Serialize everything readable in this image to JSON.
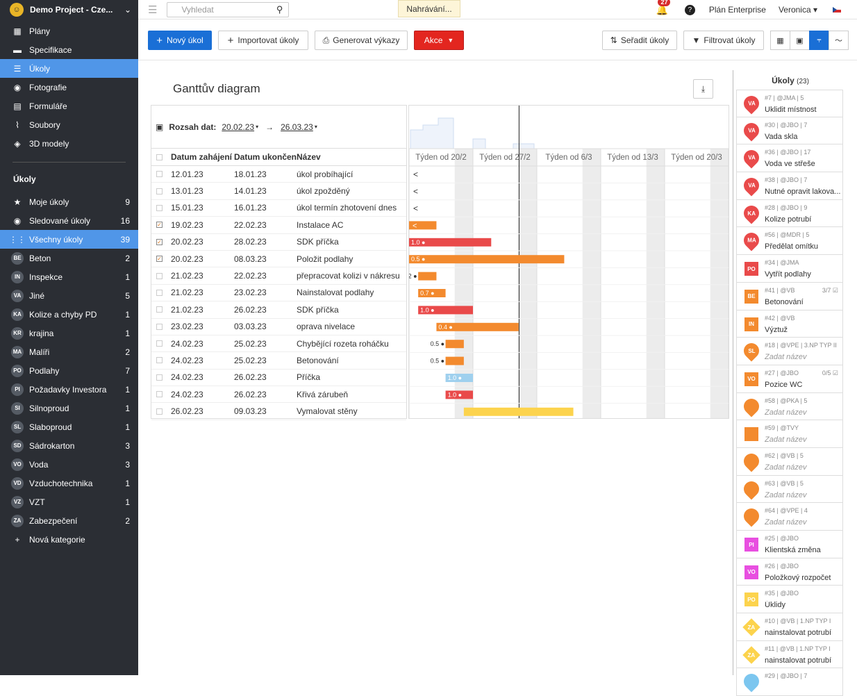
{
  "app": {
    "project_name": "Demo Project - Cze...",
    "logo_text": "☺"
  },
  "sidebar": {
    "main_items": [
      {
        "label": "Plány",
        "icon": "map-icon",
        "glyph": "▦"
      },
      {
        "label": "Specifikace",
        "icon": "book-icon",
        "glyph": "▬"
      },
      {
        "label": "Úkoly",
        "icon": "list-icon",
        "glyph": "☰",
        "active": true
      },
      {
        "label": "Fotografie",
        "icon": "camera-icon",
        "glyph": "◉"
      },
      {
        "label": "Formuláře",
        "icon": "clipboard-icon",
        "glyph": "▤"
      },
      {
        "label": "Soubory",
        "icon": "paperclip-icon",
        "glyph": "⌇"
      },
      {
        "label": "3D modely",
        "icon": "cube-icon",
        "glyph": "◈"
      }
    ],
    "tasks_title": "Úkoly",
    "task_filters": [
      {
        "label": "Moje úkoly",
        "count": "9",
        "glyph": "★",
        "icon": "star-icon"
      },
      {
        "label": "Sledované úkoly",
        "count": "16",
        "glyph": "◉",
        "icon": "eye-icon"
      },
      {
        "label": "Všechny úkoly",
        "count": "39",
        "glyph": "⋮⋮",
        "icon": "grid-icon",
        "active": true
      }
    ],
    "categories": [
      {
        "abbr": "BE",
        "label": "Beton",
        "count": "2"
      },
      {
        "abbr": "IN",
        "label": "Inspekce",
        "count": "1"
      },
      {
        "abbr": "VA",
        "label": "Jiné",
        "count": "5"
      },
      {
        "abbr": "KA",
        "label": "Kolize a chyby PD",
        "count": "1"
      },
      {
        "abbr": "KR",
        "label": "krajina",
        "count": "1"
      },
      {
        "abbr": "MA",
        "label": "Malíři",
        "count": "2"
      },
      {
        "abbr": "PO",
        "label": "Podlahy",
        "count": "7"
      },
      {
        "abbr": "PI",
        "label": "Požadavky Investora",
        "count": "1"
      },
      {
        "abbr": "SI",
        "label": "Silnoproud",
        "count": "1"
      },
      {
        "abbr": "SL",
        "label": "Slaboproud",
        "count": "1"
      },
      {
        "abbr": "SD",
        "label": "Sádrokarton",
        "count": "3"
      },
      {
        "abbr": "VO",
        "label": "Voda",
        "count": "3"
      },
      {
        "abbr": "VD",
        "label": "Vzduchotechnika",
        "count": "1"
      },
      {
        "abbr": "VZ",
        "label": "VZT",
        "count": "1"
      },
      {
        "abbr": "ZA",
        "label": "Zabezpečení",
        "count": "2"
      }
    ],
    "new_category": "Nová kategorie"
  },
  "topbar": {
    "search_placeholder": "Vyhledat",
    "upload_label": "Nahrávání...",
    "notifications": "27",
    "help": "?",
    "plan": "Plán Enterprise",
    "user": "Veronica ▾"
  },
  "toolbar": {
    "new_task": "Nový úkol",
    "import_tasks": "Importovat úkoly",
    "generate_reports": "Generovat výkazy",
    "actions": "Akce",
    "sort_tasks": "Seřadit úkoly",
    "filter_tasks": "Filtrovat úkoly"
  },
  "gantt": {
    "title": "Ganttův diagram",
    "range_label": "Rozsah dat:",
    "range_from": "20.02.23",
    "range_to": "26.03.23",
    "columns": [
      "Datum zahájení",
      "Datum ukončení",
      "Název"
    ],
    "weeks": [
      "Týden od 20/2",
      "Týden od 27/2",
      "Týden od 6/3",
      "Týden od 13/3",
      "Týden od 20/3"
    ],
    "rows": [
      {
        "start": "12.01.23",
        "end": "18.01.23",
        "name": "úkol probíhající",
        "checked": false
      },
      {
        "start": "13.01.23",
        "end": "14.01.23",
        "name": "úkol zpožděný",
        "checked": false
      },
      {
        "start": "15.01.23",
        "end": "16.01.23",
        "name": "úkol termín zhotovení dnes",
        "checked": false
      },
      {
        "start": "19.02.23",
        "end": "22.02.23",
        "name": "Instalace AC",
        "checked": true
      },
      {
        "start": "20.02.23",
        "end": "28.02.23",
        "name": "SDK příčka",
        "checked": true
      },
      {
        "start": "20.02.23",
        "end": "08.03.23",
        "name": "Položit podlahy",
        "checked": true
      },
      {
        "start": "21.02.23",
        "end": "22.02.23",
        "name": "přepracovat kolizi v nákresu",
        "checked": false
      },
      {
        "start": "21.02.23",
        "end": "23.02.23",
        "name": "Nainstalovat podlahy",
        "checked": false
      },
      {
        "start": "21.02.23",
        "end": "26.02.23",
        "name": "SDK příčka",
        "checked": false
      },
      {
        "start": "23.02.23",
        "end": "03.03.23",
        "name": "oprava nivelace",
        "checked": false
      },
      {
        "start": "24.02.23",
        "end": "25.02.23",
        "name": "Chybějící rozeta roháčku",
        "checked": false
      },
      {
        "start": "24.02.23",
        "end": "25.02.23",
        "name": "Betonování",
        "checked": false
      },
      {
        "start": "24.02.23",
        "end": "26.02.23",
        "name": "Příčka",
        "checked": false
      },
      {
        "start": "24.02.23",
        "end": "26.02.23",
        "name": "Křivá zárubeň",
        "checked": false
      },
      {
        "start": "26.02.23",
        "end": "09.03.23",
        "name": "Vymalovat stěny",
        "checked": false
      }
    ],
    "bars": [
      {
        "arrow": true
      },
      {
        "arrow": true
      },
      {
        "arrow": true
      },
      {
        "color": "#f38a2e",
        "arrow": true
      },
      {
        "color": "#e94a4a",
        "label": "1.0"
      },
      {
        "color": "#f38a2e",
        "label": "0.5"
      },
      {
        "color": "#f38a2e",
        "label": "0.2",
        "outside": true
      },
      {
        "color": "#f38a2e",
        "label": "0.7"
      },
      {
        "color": "#e94a4a",
        "label": "1.0"
      },
      {
        "color": "#f38a2e",
        "label": "0.4"
      },
      {
        "color": "#f38a2e",
        "label": "0.5",
        "outside": true
      },
      {
        "color": "#f38a2e",
        "label": "0.5",
        "outside": true
      },
      {
        "color": "#9fd0ee",
        "label": "1.0"
      },
      {
        "color": "#e94a4a",
        "label": "1.0"
      },
      {
        "color": "#fcd34d"
      }
    ]
  },
  "task_panel": {
    "title": "Úkoly",
    "count": "(23)",
    "items": [
      {
        "meta": "#7 | @JMA | 5",
        "name": "Uklidit místnost",
        "abbr": "VA",
        "shape": "pin",
        "color": "#e94a4a"
      },
      {
        "meta": "#30 | @JBO | 7",
        "name": "Vada skla",
        "abbr": "VA",
        "shape": "pin",
        "color": "#e94a4a"
      },
      {
        "meta": "#36 | @JBO | 17",
        "name": "Voda ve střeše",
        "abbr": "VA",
        "shape": "pin",
        "color": "#e94a4a"
      },
      {
        "meta": "#38 | @JBO | 7",
        "name": "Nutné opravit lakova...",
        "abbr": "VA",
        "shape": "pin",
        "color": "#e94a4a"
      },
      {
        "meta": "#28 | @JBO | 9",
        "name": "Kolize potrubí",
        "abbr": "KA",
        "shape": "pin",
        "color": "#e94a4a"
      },
      {
        "meta": "#56 | @MDR | 5",
        "name": "Předělat omítku",
        "abbr": "MA",
        "shape": "pin",
        "color": "#e94a4a"
      },
      {
        "meta": "#34 | @JMA",
        "name": "Vytřít podlahy",
        "abbr": "PO",
        "shape": "sq",
        "color": "#e94a4a"
      },
      {
        "meta": "#41 | @VB",
        "name": "Betonování",
        "abbr": "BE",
        "shape": "sq",
        "color": "#f38a2e",
        "extra": "3/7 ☑"
      },
      {
        "meta": "#42 | @VB",
        "name": "Výztuž",
        "abbr": "IN",
        "shape": "sq",
        "color": "#f38a2e"
      },
      {
        "meta": "#18 | @VPE | 3.NP TYP II",
        "name": "Zadat název",
        "abbr": "SL",
        "shape": "pin",
        "color": "#f38a2e",
        "placeholder": true
      },
      {
        "meta": "#27 | @JBO",
        "name": "Pozice WC",
        "abbr": "VO",
        "shape": "sq",
        "color": "#f38a2e",
        "extra": "0/5 ☑"
      },
      {
        "meta": "#58 | @PKA | 5",
        "name": "Zadat název",
        "abbr": "",
        "shape": "pin",
        "color": "#f38a2e",
        "placeholder": true
      },
      {
        "meta": "#59 | @TVY",
        "name": "Zadat název",
        "abbr": "",
        "shape": "sq",
        "color": "#f38a2e",
        "placeholder": true
      },
      {
        "meta": "#62 | @VB | 5",
        "name": "Zadat název",
        "abbr": "",
        "shape": "pin",
        "color": "#f38a2e",
        "placeholder": true
      },
      {
        "meta": "#63 | @VB | 5",
        "name": "Zadat název",
        "abbr": "",
        "shape": "pin",
        "color": "#f38a2e",
        "placeholder": true
      },
      {
        "meta": "#64 | @VPE | 4",
        "name": "Zadat název",
        "abbr": "",
        "shape": "pin",
        "color": "#f38a2e",
        "placeholder": true
      },
      {
        "meta": "#25 | @JBO",
        "name": "Klientská změna",
        "abbr": "PI",
        "shape": "sq",
        "color": "#e84fe0"
      },
      {
        "meta": "#26 | @JBO",
        "name": "Položkový rozpočet",
        "abbr": "VO",
        "shape": "sq",
        "color": "#e84fe0"
      },
      {
        "meta": "#35 | @JBO",
        "name": "Úklidy",
        "abbr": "PO",
        "shape": "sq",
        "color": "#fcd34d"
      },
      {
        "meta": "#10 | @VB | 1.NP TYP I",
        "name": "nainstalovat potrubí",
        "abbr": "ZA",
        "shape": "dia",
        "color": "#fcd34d"
      },
      {
        "meta": "#11 | @VB | 1.NP TYP I",
        "name": "nainstalovat potrubí",
        "abbr": "ZA",
        "shape": "dia",
        "color": "#fcd34d"
      },
      {
        "meta": "#29 | @JBO | 7",
        "name": "",
        "abbr": "",
        "shape": "pin",
        "color": "#7cc6ef"
      }
    ]
  }
}
